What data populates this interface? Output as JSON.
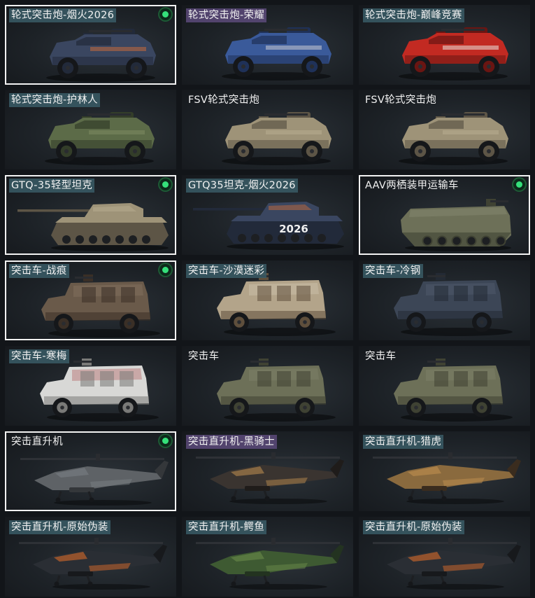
{
  "colors": {
    "equipped_border": "#f2f2f2",
    "equipped_dot": "#35e07a",
    "tag_teal": "#3a5c66",
    "tag_purple": "#5c4a7a"
  },
  "items": [
    {
      "name": "轮式突击炮-烟火2026",
      "tag": "teal",
      "equipped": true,
      "vehicle": "wheeled",
      "skin": "firework"
    },
    {
      "name": "轮式突击炮-荣耀",
      "tag": "purple",
      "equipped": false,
      "vehicle": "wheeled",
      "skin": "glory"
    },
    {
      "name": "轮式突击炮-巅峰竞赛",
      "tag": "teal",
      "equipped": false,
      "vehicle": "wheeled",
      "skin": "red"
    },
    {
      "name": "轮式突击炮-护林人",
      "tag": "teal",
      "equipped": false,
      "vehicle": "wheeled",
      "skin": "forest"
    },
    {
      "name": "FSV轮式突击炮",
      "tag": "none",
      "equipped": false,
      "vehicle": "wheeled",
      "skin": "sand"
    },
    {
      "name": "FSV轮式突击炮",
      "tag": "none",
      "equipped": false,
      "vehicle": "wheeled",
      "skin": "sand"
    },
    {
      "name": "GTQ-35轻型坦克",
      "tag": "teal",
      "equipped": true,
      "vehicle": "tank",
      "skin": "sand"
    },
    {
      "name": "GTQ35坦克-烟火2026",
      "tag": "teal",
      "equipped": false,
      "vehicle": "tank",
      "skin": "firework",
      "decal": "2026"
    },
    {
      "name": "AAV两栖装甲运输车",
      "tag": "none",
      "equipped": true,
      "vehicle": "aav",
      "skin": "olive"
    },
    {
      "name": "突击车-战痕",
      "tag": "teal",
      "equipped": true,
      "vehicle": "assault",
      "skin": "battle"
    },
    {
      "name": "突击车-沙漠迷彩",
      "tag": "teal",
      "equipped": false,
      "vehicle": "assault",
      "skin": "desert"
    },
    {
      "name": "突击车-冷钢",
      "tag": "teal",
      "equipped": false,
      "vehicle": "assault",
      "skin": "steel"
    },
    {
      "name": "突击车-寒梅",
      "tag": "teal",
      "equipped": false,
      "vehicle": "assault",
      "skin": "white"
    },
    {
      "name": "突击车",
      "tag": "none",
      "equipped": false,
      "vehicle": "assault",
      "skin": "olive"
    },
    {
      "name": "突击车",
      "tag": "none",
      "equipped": false,
      "vehicle": "assault",
      "skin": "olive"
    },
    {
      "name": "突击直升机",
      "tag": "none",
      "equipped": true,
      "vehicle": "heli",
      "skin": "grey"
    },
    {
      "name": "突击直升机-黑骑士",
      "tag": "purple",
      "equipped": false,
      "vehicle": "heli",
      "skin": "blackknight"
    },
    {
      "name": "突击直升机-猎虎",
      "tag": "teal",
      "equipped": false,
      "vehicle": "heli",
      "skin": "tiger"
    },
    {
      "name": "突击直升机-原始伪装",
      "tag": "teal",
      "equipped": false,
      "vehicle": "heli",
      "skin": "primal"
    },
    {
      "name": "突击直升机-鳄鱼",
      "tag": "teal",
      "equipped": false,
      "vehicle": "heli",
      "skin": "croc"
    },
    {
      "name": "突击直升机-原始伪装",
      "tag": "teal",
      "equipped": false,
      "vehicle": "heli",
      "skin": "primal"
    }
  ]
}
